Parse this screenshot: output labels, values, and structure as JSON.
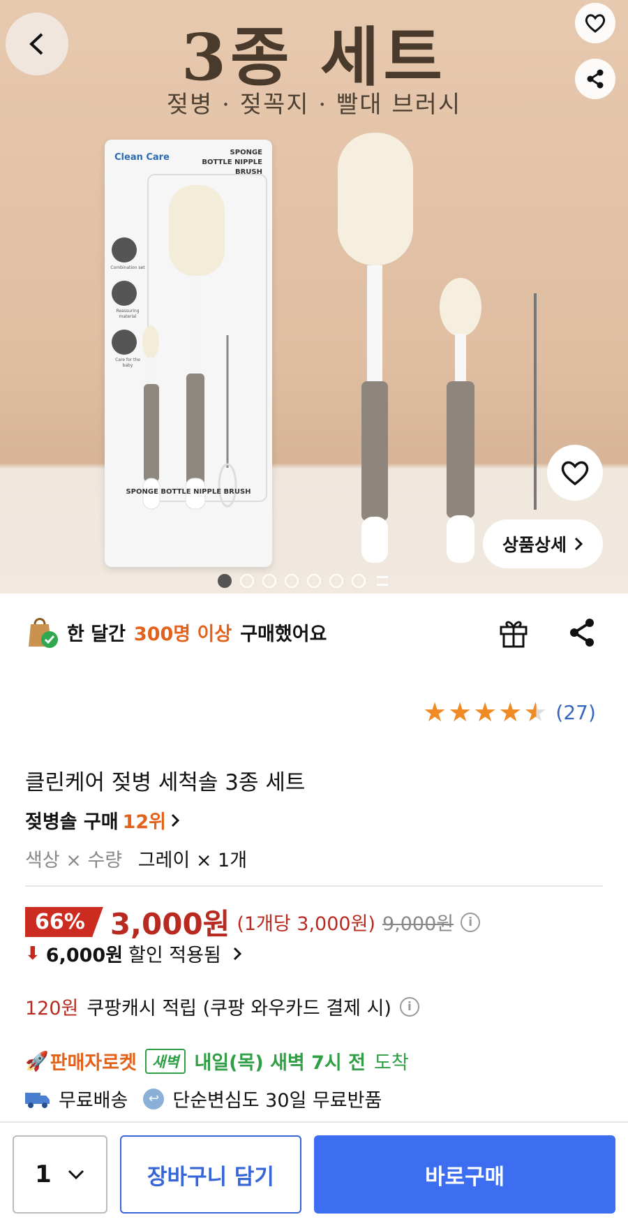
{
  "hero": {
    "title": "3종 세트",
    "subtitle": "젖병 · 젖꼭지 · 빨대 브러시",
    "package": {
      "brand": "Clean Care",
      "label": "SPONGE BOTTLE NIPPLE BRUSH",
      "bottom_label": "SPONGE BOTTLE NIPPLE BRUSH",
      "features": [
        "Combination set",
        "Reassuring material",
        "Care for the baby"
      ]
    },
    "detail_button": "상품상세",
    "carousel": {
      "total_dots": 7,
      "active_index": 0
    }
  },
  "buyers": {
    "prefix": "한 달간",
    "count": "300명 이상",
    "suffix": "구매했어요"
  },
  "rating": {
    "stars": 4.5,
    "count": "(27)"
  },
  "product": {
    "title": "클린케어 젖병 세척솔 3종 세트",
    "rank_label": "젖병솔 구매",
    "rank_value": "12위",
    "option_label": "색상 × 수량",
    "option_value": "그레이 × 1개"
  },
  "price": {
    "discount": "66%",
    "sale": "3,000원",
    "unit": "(1개당 3,000원)",
    "original": "9,000원",
    "saving_amount": "6,000원",
    "saving_text": "할인 적용됨"
  },
  "cash": {
    "amount": "120원",
    "text": "쿠팡캐시 적립 (쿠팡 와우카드 결제 시)"
  },
  "delivery": {
    "badge_text": "판매자로켓",
    "dawn_badge": "새벽",
    "eta_bold": "내일(목) 새벽 7시 전",
    "eta_suffix": "도착"
  },
  "shipping": {
    "free": "무료배송",
    "returns": "단순변심도 30일 무료반품"
  },
  "bottom": {
    "qty": "1",
    "cart_button": "장바구니 담기",
    "buy_button": "바로구매"
  },
  "colors": {
    "accent": "#3d6df0",
    "discount": "#cc2b20",
    "orange": "#e2621b",
    "green": "#2f9e45"
  }
}
